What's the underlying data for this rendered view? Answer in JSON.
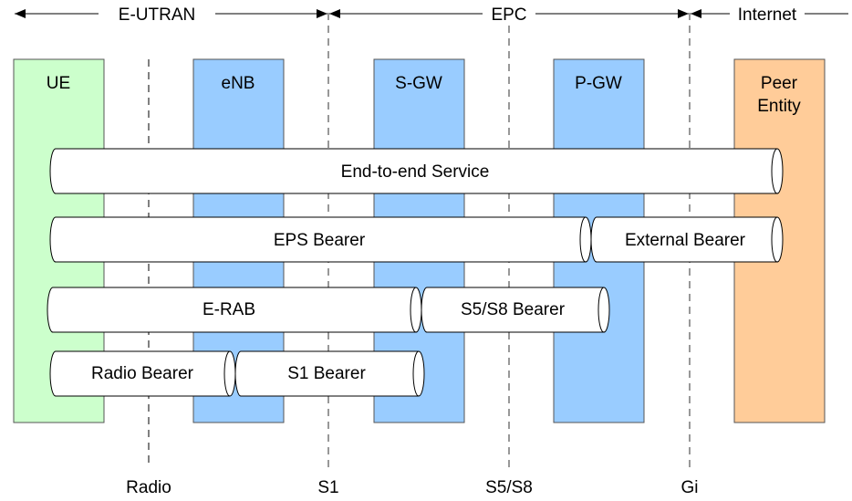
{
  "domains": {
    "e_utran": "E-UTRAN",
    "epc": "EPC",
    "internet": "Internet"
  },
  "nodes": {
    "ue": "UE",
    "enb": "eNB",
    "sgw": "S-GW",
    "pgw": "P-GW",
    "peer_line1": "Peer",
    "peer_line2": "Entity"
  },
  "interfaces": {
    "radio": "Radio",
    "s1": "S1",
    "s5s8": "S5/S8",
    "gi": "Gi"
  },
  "bearers": {
    "end_to_end": "End-to-end Service",
    "eps": "EPS Bearer",
    "external": "External Bearer",
    "erab": "E-RAB",
    "s5s8": "S5/S8 Bearer",
    "radio": "Radio Bearer",
    "s1": "S1 Bearer"
  },
  "colors": {
    "ue": "#ccffcc",
    "network_node": "#99ccff",
    "peer": "#ffcc99"
  }
}
